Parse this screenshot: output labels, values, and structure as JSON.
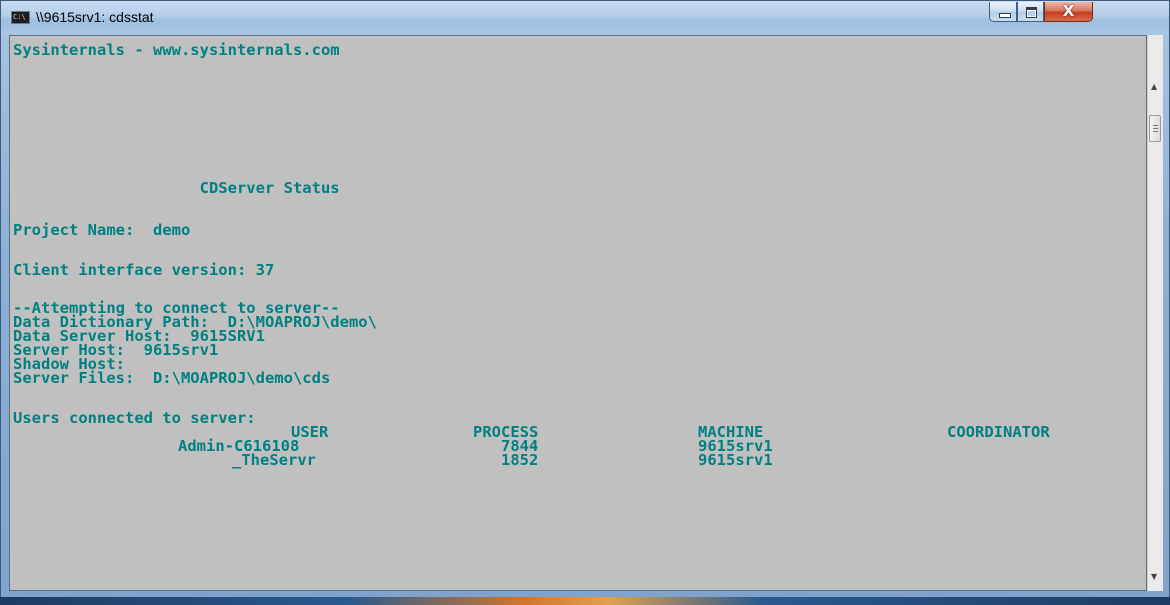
{
  "window": {
    "title": "\\\\9615srv1: cdsstat",
    "icon_label": "C:\\",
    "close_glyph": "X"
  },
  "console": {
    "lines": [
      "Sysinternals - www.sysinternals.com",
      "                    CDServer Status",
      "Project Name:  demo",
      "Client interface version: 37",
      "--Attempting to connect to server--",
      "Data Dictionary Path:  D:\\MOAPROJ\\demo\\",
      "Data Server Host:  9615SRV1",
      "Server Host:  9615srv1",
      "Shadow Host:",
      "Server Files:  D:\\MOAPROJ\\demo\\cds",
      "Users connected to server:"
    ],
    "users_table": {
      "headers": [
        "USER",
        "PROCESS",
        "MACHINE",
        "COORDINATOR"
      ],
      "rows": [
        [
          "Admin-C616108",
          "7844",
          "9615srv1",
          ""
        ],
        [
          "_TheServr",
          "1852",
          "9615srv1",
          ""
        ]
      ]
    }
  },
  "colors": {
    "console_bg": "#c0c0c0",
    "console_text": "#008080"
  },
  "icons": [
    "console-app-icon",
    "minimize-icon",
    "maximize-icon",
    "close-icon",
    "scroll-up-icon",
    "scroll-down-icon"
  ]
}
